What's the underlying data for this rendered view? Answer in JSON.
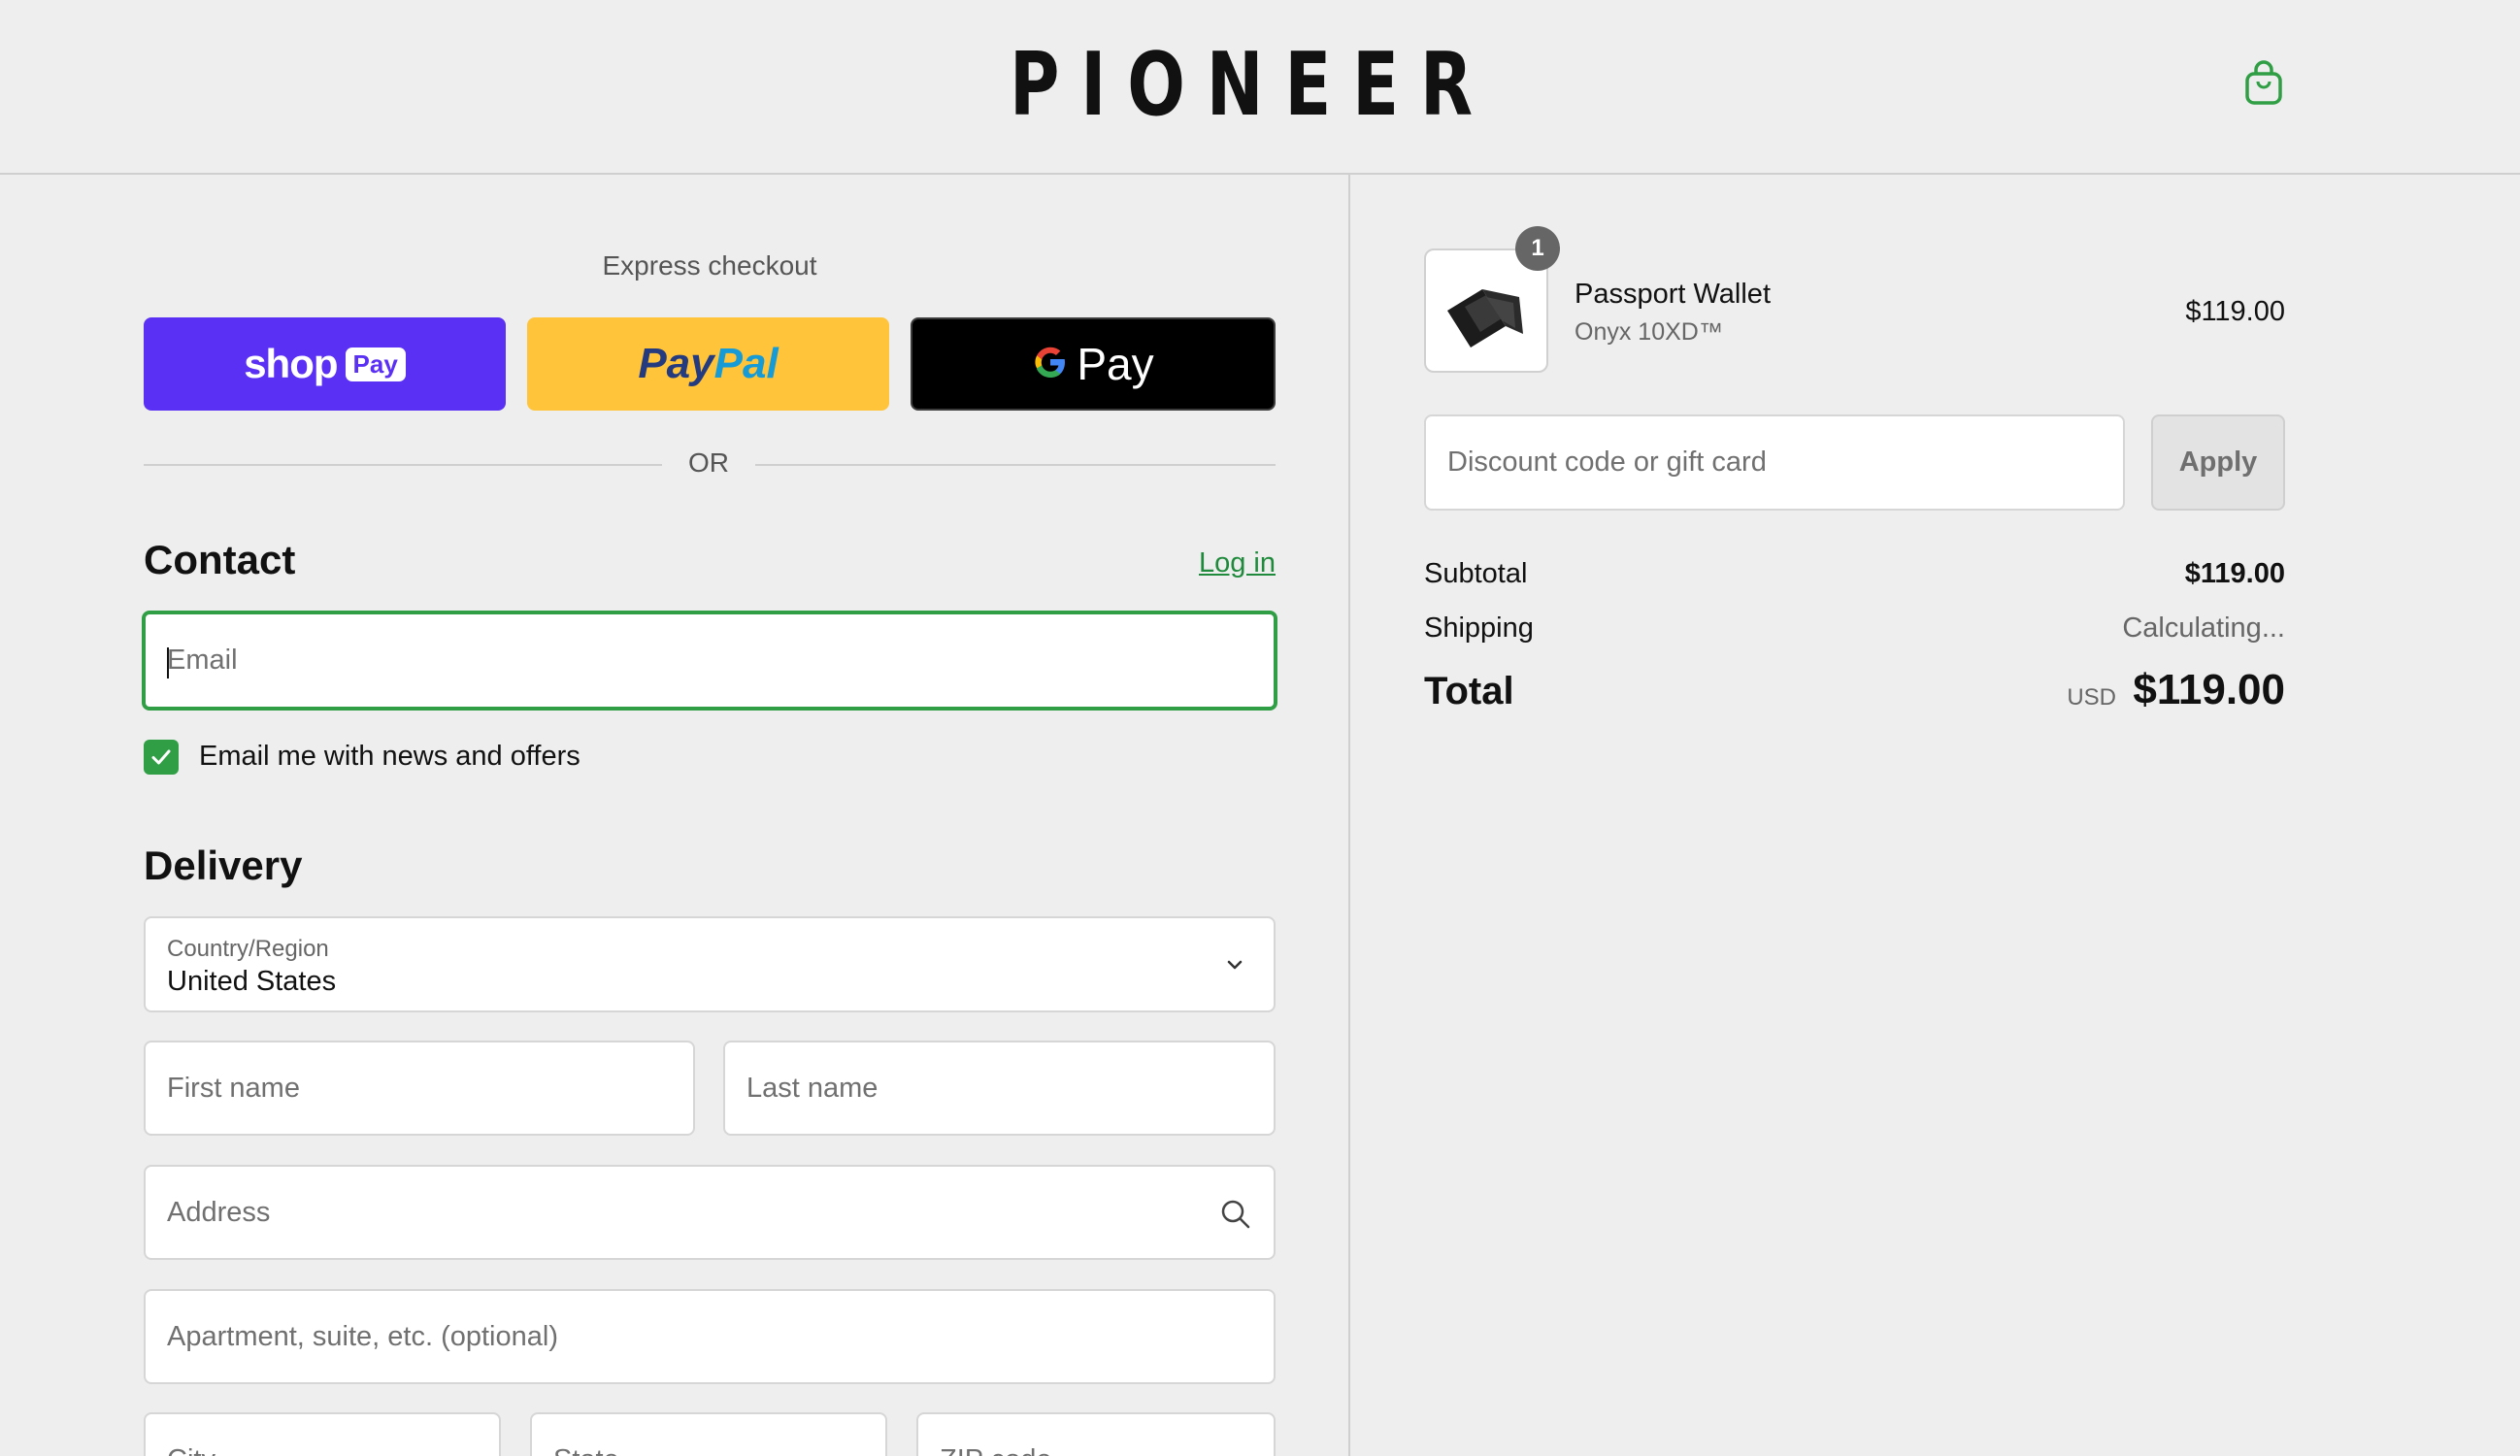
{
  "header": {
    "brand": "PIONEER",
    "cart_icon": "shopping-bag-icon"
  },
  "express": {
    "title": "Express checkout",
    "shop_pay": {
      "word": "shop",
      "tag": "Pay"
    },
    "paypal": {
      "part1": "Pay",
      "part2": "Pal"
    },
    "google_pay": {
      "text": "Pay",
      "logo": "google-g-icon"
    },
    "or_text": "OR"
  },
  "contact": {
    "title": "Contact",
    "login": "Log in",
    "email_placeholder": "Email",
    "news_checkbox": {
      "label": "Email me with news and offers",
      "checked": true
    }
  },
  "delivery": {
    "title": "Delivery",
    "country": {
      "label": "Country/Region",
      "value": "United States"
    },
    "first_name": "First name",
    "last_name": "Last name",
    "address": "Address",
    "apartment": "Apartment, suite, etc. (optional)",
    "city": "City",
    "state": "State",
    "zip": "ZIP code"
  },
  "order": {
    "item": {
      "quantity": "1",
      "name": "Passport Wallet",
      "variant": "Onyx 10XD™",
      "price": "$119.00"
    },
    "discount_placeholder": "Discount code or gift card",
    "apply": "Apply",
    "subtotal_label": "Subtotal",
    "subtotal": "$119.00",
    "shipping_label": "Shipping",
    "shipping": "Calculating...",
    "total_label": "Total",
    "currency": "USD",
    "total": "$119.00"
  },
  "colors": {
    "accent_green": "#2f9e44",
    "shop_pay": "#5a31f4",
    "paypal_yellow": "#ffc439",
    "google_pay_black": "#000000"
  }
}
